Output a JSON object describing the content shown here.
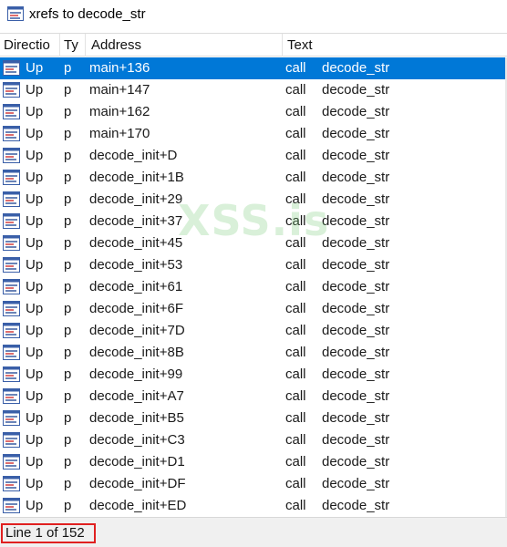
{
  "window": {
    "title": "xrefs to decode_str",
    "icon": "xrefs-window-icon"
  },
  "columns": {
    "direction": "Directio",
    "type": "Ty",
    "address": "Address",
    "text": "Text"
  },
  "rows": [
    {
      "direction": "Up",
      "type": "p",
      "address": "main+136",
      "op": "call",
      "target": "decode_str",
      "selected": true
    },
    {
      "direction": "Up",
      "type": "p",
      "address": "main+147",
      "op": "call",
      "target": "decode_str"
    },
    {
      "direction": "Up",
      "type": "p",
      "address": "main+162",
      "op": "call",
      "target": "decode_str"
    },
    {
      "direction": "Up",
      "type": "p",
      "address": "main+170",
      "op": "call",
      "target": "decode_str"
    },
    {
      "direction": "Up",
      "type": "p",
      "address": "decode_init+D",
      "op": "call",
      "target": "decode_str"
    },
    {
      "direction": "Up",
      "type": "p",
      "address": "decode_init+1B",
      "op": "call",
      "target": "decode_str"
    },
    {
      "direction": "Up",
      "type": "p",
      "address": "decode_init+29",
      "op": "call",
      "target": "decode_str"
    },
    {
      "direction": "Up",
      "type": "p",
      "address": "decode_init+37",
      "op": "call",
      "target": "decode_str"
    },
    {
      "direction": "Up",
      "type": "p",
      "address": "decode_init+45",
      "op": "call",
      "target": "decode_str"
    },
    {
      "direction": "Up",
      "type": "p",
      "address": "decode_init+53",
      "op": "call",
      "target": "decode_str"
    },
    {
      "direction": "Up",
      "type": "p",
      "address": "decode_init+61",
      "op": "call",
      "target": "decode_str"
    },
    {
      "direction": "Up",
      "type": "p",
      "address": "decode_init+6F",
      "op": "call",
      "target": "decode_str"
    },
    {
      "direction": "Up",
      "type": "p",
      "address": "decode_init+7D",
      "op": "call",
      "target": "decode_str"
    },
    {
      "direction": "Up",
      "type": "p",
      "address": "decode_init+8B",
      "op": "call",
      "target": "decode_str"
    },
    {
      "direction": "Up",
      "type": "p",
      "address": "decode_init+99",
      "op": "call",
      "target": "decode_str"
    },
    {
      "direction": "Up",
      "type": "p",
      "address": "decode_init+A7",
      "op": "call",
      "target": "decode_str"
    },
    {
      "direction": "Up",
      "type": "p",
      "address": "decode_init+B5",
      "op": "call",
      "target": "decode_str"
    },
    {
      "direction": "Up",
      "type": "p",
      "address": "decode_init+C3",
      "op": "call",
      "target": "decode_str"
    },
    {
      "direction": "Up",
      "type": "p",
      "address": "decode_init+D1",
      "op": "call",
      "target": "decode_str"
    },
    {
      "direction": "Up",
      "type": "p",
      "address": "decode_init+DF",
      "op": "call",
      "target": "decode_str"
    },
    {
      "direction": "Up",
      "type": "p",
      "address": "decode_init+ED",
      "op": "call",
      "target": "decode_str"
    }
  ],
  "row_icon": "xref-row-icon",
  "watermark": "XSS.is",
  "status": {
    "text": "Line 1 of 152"
  },
  "colors": {
    "selection": "#0078d7",
    "status_highlight": "#e02020",
    "watermark": "#78c878"
  }
}
